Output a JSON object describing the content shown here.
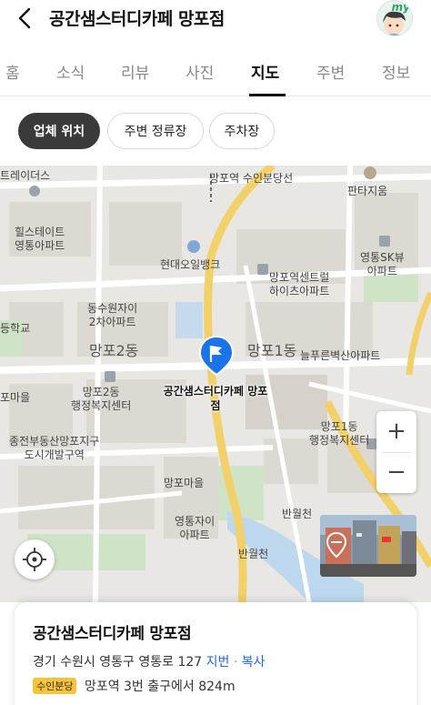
{
  "header": {
    "title": "공간샘스터디카페 망포점",
    "avatar_text": "my"
  },
  "tabs": [
    {
      "label": "홈"
    },
    {
      "label": "소식"
    },
    {
      "label": "리뷰"
    },
    {
      "label": "사진"
    },
    {
      "label": "지도"
    },
    {
      "label": "주변"
    },
    {
      "label": "정보"
    }
  ],
  "active_tab": "지도",
  "chips": [
    {
      "label": "업체 위치"
    },
    {
      "label": "주변 정류장"
    },
    {
      "label": "주차장"
    }
  ],
  "map": {
    "labels": {
      "l0": "트레이더스",
      "l1": "망포역 수인분당선",
      "l2": "판타지움",
      "l3": "힐스테이트\n영통아파트",
      "l4": "현대오일뱅크",
      "l5": "영통SK뷰\n아파트",
      "l6": "망포역센트럴\n하이츠아파트",
      "l7": "동수원자이\n2차아파트",
      "l8": "망포2동",
      "l9": "망포1동",
      "l10": "늘푸른벽산아파트",
      "l11": "등학교",
      "l12": "포마을",
      "l13": "망포2동\n행정복지센터",
      "l14": "망포1동\n행정복지센터",
      "l15": "종전부동산망포지구\n도시개발구역",
      "l16": "망포마을",
      "l17": "반월천",
      "l18": "영통자이\n아파트",
      "l19": "반월천"
    },
    "poi_label": "공간샘스터디카페 망포\n점",
    "zoom_in": "+",
    "zoom_out": "−",
    "colors": {
      "background": "#e9e7e3",
      "road": "#ffffff",
      "main_road": "#f5d76e",
      "block": "#dcd9d3",
      "green": "#cfe3c6",
      "water": "#bcd7ee",
      "pin": "#1a73e8"
    }
  },
  "card": {
    "title": "공간샘스터디카페 망포점",
    "address": "경기 수원시 영통구 영통로 127",
    "jibun_link": "지번",
    "copy_link": "복사",
    "subway_badge": "수인분당",
    "distance": "망포역 3번 출구에서 824m"
  }
}
